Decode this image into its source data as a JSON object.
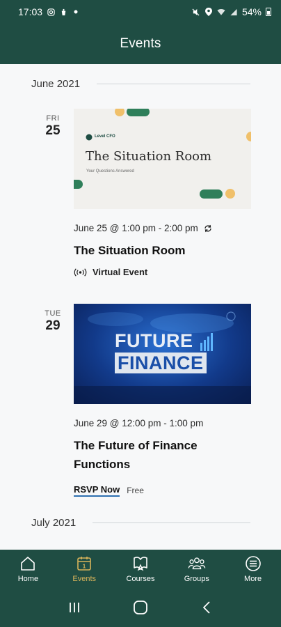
{
  "status_bar": {
    "time": "17:03",
    "battery": "54%"
  },
  "app_bar": {
    "title": "Events"
  },
  "months": [
    {
      "label": "June 2021"
    },
    {
      "label": "July 2021"
    }
  ],
  "events": [
    {
      "dow": "FRI",
      "day": "25",
      "image": {
        "logo": "Level CFO",
        "heading": "The Situation Room",
        "subheading": "Your Questions Answered"
      },
      "time": "June 25 @ 1:00 pm - 2:00 pm",
      "recurring_icon": "repeat-icon",
      "title": "The Situation Room",
      "tag": "Virtual Event",
      "tag_icon": "broadcast-icon"
    },
    {
      "dow": "TUE",
      "day": "29",
      "image": {
        "line1": "FUTURE",
        "line2": "FINANCE"
      },
      "time": "June 29 @ 12:00 pm - 1:00 pm",
      "title": "The Future of Finance Functions",
      "rsvp": "RSVP Now",
      "price": "Free"
    }
  ],
  "bottom_nav": [
    {
      "label": "Home",
      "icon": "home-icon",
      "active": false
    },
    {
      "label": "Events",
      "icon": "calendar-icon",
      "active": true
    },
    {
      "label": "Courses",
      "icon": "courses-icon",
      "active": false
    },
    {
      "label": "Groups",
      "icon": "groups-icon",
      "active": false
    },
    {
      "label": "More",
      "icon": "menu-icon",
      "active": false
    }
  ],
  "calendar_icon_number": "1",
  "colors": {
    "primary": "#1f4d43",
    "accent": "#d8b45a",
    "background": "#f7f8f9"
  }
}
